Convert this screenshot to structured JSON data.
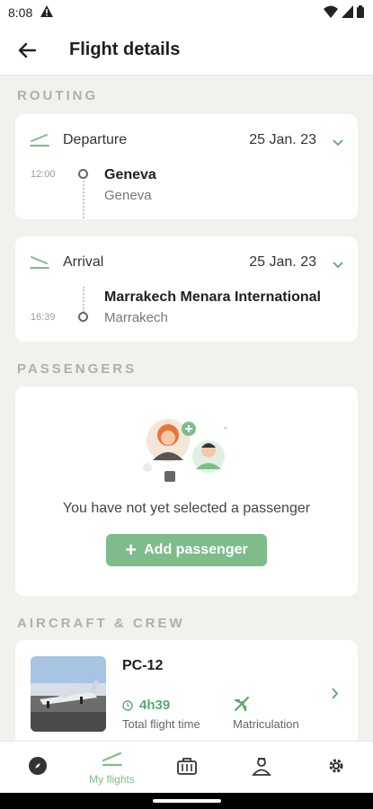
{
  "status_bar": {
    "time": "8:08"
  },
  "header": {
    "title": "Flight details"
  },
  "sections": {
    "routing": "ROUTING",
    "passengers": "PASSENGERS",
    "aircraft_crew": "AIRCRAFT & CREW"
  },
  "departure": {
    "label": "Departure",
    "date": "25 Jan. 23",
    "time": "12:00",
    "airport": "Geneva",
    "city": "Geneva"
  },
  "arrival": {
    "label": "Arrival",
    "date": "25 Jan. 23",
    "time": "16:39",
    "airport": "Marrakech Menara International",
    "city": "Marrakech"
  },
  "passengers": {
    "empty_message": "You have not yet selected a passenger",
    "add_label": "Add passenger"
  },
  "aircraft": {
    "model": "PC-12",
    "flight_time": "4h39",
    "flight_time_label": "Total flight time",
    "matriculation_label": "Matriculation"
  },
  "bottom_nav": {
    "active_label": "My flights"
  },
  "colors": {
    "accent": "#7fbc8c",
    "accent_dark": "#5ea771"
  }
}
